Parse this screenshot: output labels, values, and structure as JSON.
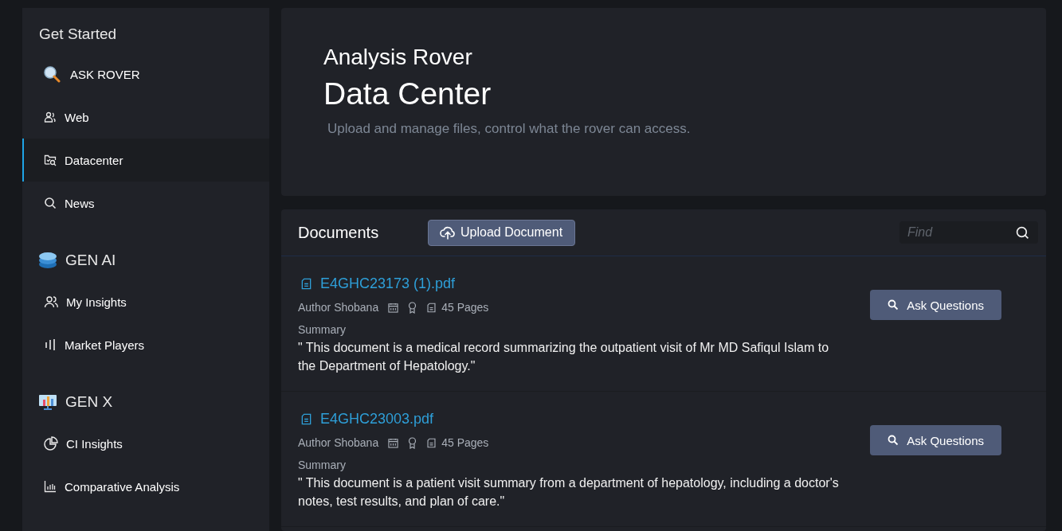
{
  "sidebar": {
    "heading": "Get Started",
    "sections": [
      {
        "items": [
          {
            "label": "ASK ROVER",
            "selected": false,
            "kind": "featured"
          },
          {
            "label": "Web",
            "selected": false
          },
          {
            "label": "Datacenter",
            "selected": true
          },
          {
            "label": "News",
            "selected": false
          }
        ]
      },
      {
        "title": "GEN AI",
        "items": [
          {
            "label": "My Insights",
            "selected": false
          },
          {
            "label": "Market Players",
            "selected": false
          }
        ]
      },
      {
        "title": "GEN X",
        "items": [
          {
            "label": "CI Insights",
            "selected": false
          },
          {
            "label": "Comparative Analysis",
            "selected": false
          }
        ]
      }
    ]
  },
  "header": {
    "subtitle": "Analysis Rover",
    "title": "Data Center",
    "description": "Upload and manage files, control what the rover can access."
  },
  "documents": {
    "title": "Documents",
    "upload_button": "Upload Document",
    "search": {
      "placeholder": "Find"
    },
    "items": [
      {
        "name": "E4GHC23173 (1).pdf",
        "author": "Author Shobana",
        "pages": "45 Pages",
        "summary_label": "Summary",
        "summary": "\" This document is a medical record summarizing the outpatient visit of Mr MD Safiqul Islam to the Department of Hepatology.\"",
        "button": "Ask Questions"
      },
      {
        "name": "E4GHC23003.pdf",
        "author": "Author Shobana",
        "pages": "45 Pages",
        "summary_label": "Summary",
        "summary": "\" This document is a patient visit summary from a department of hepatology, including a doctor's notes, test results, and plan of care.\"",
        "button": "Ask Questions"
      }
    ]
  }
}
